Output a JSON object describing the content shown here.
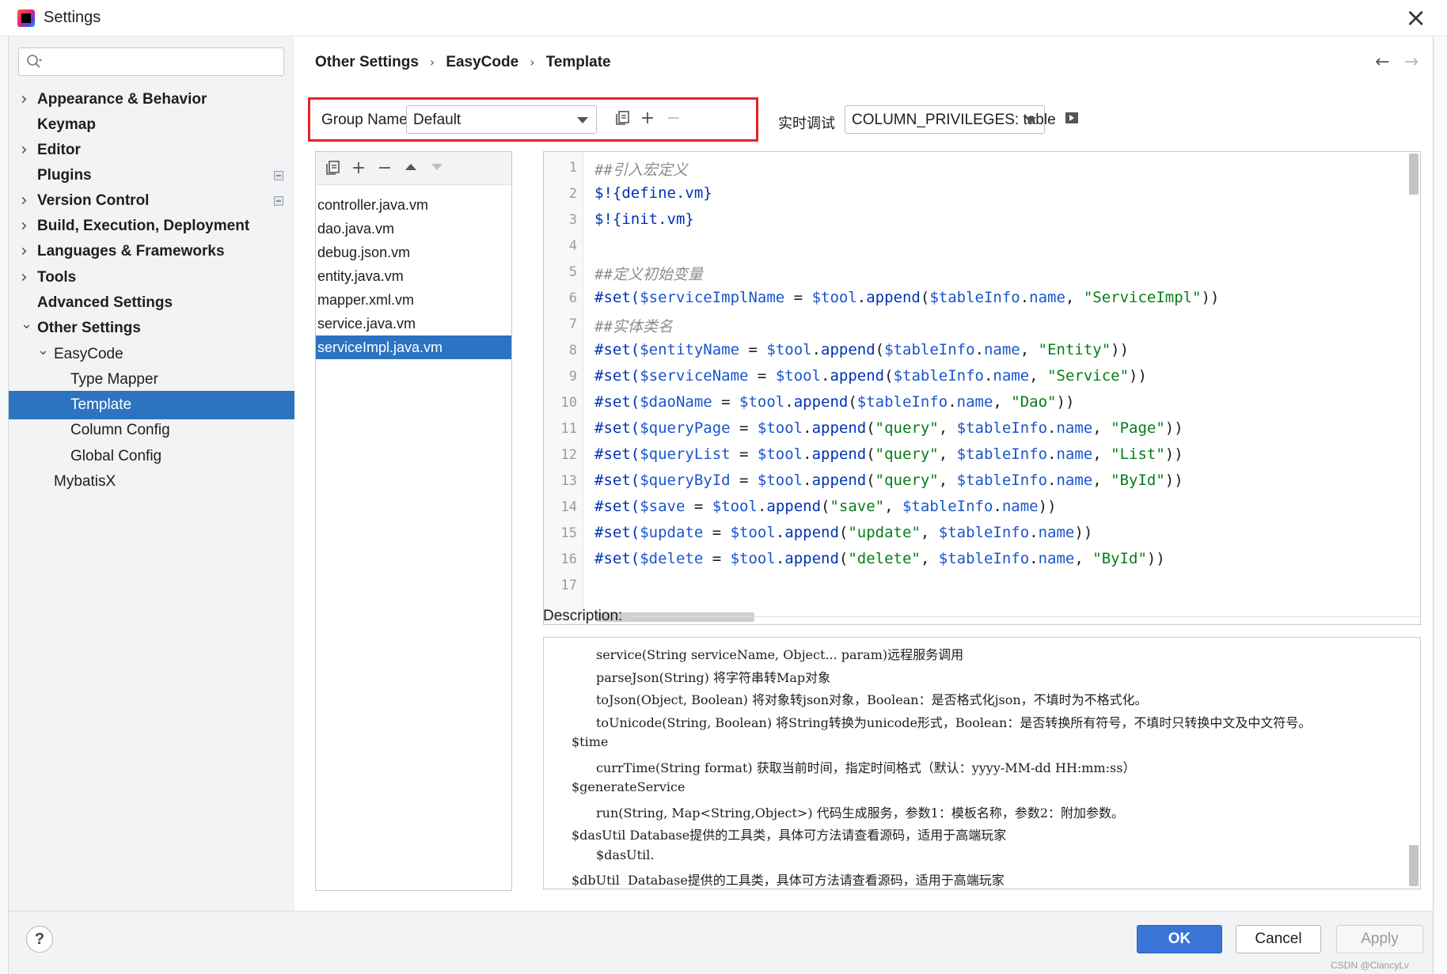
{
  "window": {
    "title": "Settings"
  },
  "sidebar": {
    "search_placeholder": "",
    "items": [
      {
        "label": "Appearance & Behavior",
        "bold": true,
        "chevron": "right",
        "indent": 0
      },
      {
        "label": "Keymap",
        "bold": true,
        "chevron": "none",
        "indent": 0
      },
      {
        "label": "Editor",
        "bold": true,
        "chevron": "right",
        "indent": 0
      },
      {
        "label": "Plugins",
        "bold": true,
        "chevron": "none",
        "indent": 0,
        "badge": true
      },
      {
        "label": "Version Control",
        "bold": true,
        "chevron": "right",
        "indent": 0,
        "badge": true
      },
      {
        "label": "Build, Execution, Deployment",
        "bold": true,
        "chevron": "right",
        "indent": 0
      },
      {
        "label": "Languages & Frameworks",
        "bold": true,
        "chevron": "right",
        "indent": 0
      },
      {
        "label": "Tools",
        "bold": true,
        "chevron": "right",
        "indent": 0
      },
      {
        "label": "Advanced Settings",
        "bold": true,
        "chevron": "none",
        "indent": 0
      },
      {
        "label": "Other Settings",
        "bold": true,
        "chevron": "down",
        "indent": 0
      },
      {
        "label": "EasyCode",
        "bold": false,
        "chevron": "down",
        "indent": 1
      },
      {
        "label": "Type Mapper",
        "bold": false,
        "chevron": "none",
        "indent": 2
      },
      {
        "label": "Template",
        "bold": false,
        "chevron": "none",
        "indent": 2,
        "selected": true
      },
      {
        "label": "Column Config",
        "bold": false,
        "chevron": "none",
        "indent": 2
      },
      {
        "label": "Global Config",
        "bold": false,
        "chevron": "none",
        "indent": 2
      },
      {
        "label": "MybatisX",
        "bold": false,
        "chevron": "none",
        "indent": 1
      }
    ]
  },
  "breadcrumb": [
    "Other Settings",
    "EasyCode",
    "Template"
  ],
  "group": {
    "label": "Group Name:",
    "value": "Default",
    "highlight_color": "#e8202a"
  },
  "debug": {
    "label": "实时调试",
    "value": "COLUMN_PRIVILEGES: table"
  },
  "templates": {
    "items": [
      "controller.java.vm",
      "dao.java.vm",
      "debug.json.vm",
      "entity.java.vm",
      "mapper.xml.vm",
      "service.java.vm",
      "serviceImpl.java.vm"
    ],
    "selected_index": 6
  },
  "editor": {
    "lines": [
      {
        "n": "1",
        "t": [
          [
            "c",
            "##引入宏定义"
          ]
        ]
      },
      {
        "n": "2",
        "t": [
          [
            "k",
            "$!{define.vm}"
          ]
        ]
      },
      {
        "n": "3",
        "t": [
          [
            "k",
            "$!{init.vm}"
          ]
        ]
      },
      {
        "n": "4",
        "t": []
      },
      {
        "n": "5",
        "t": [
          [
            "c",
            "##定义初始变量"
          ]
        ]
      },
      {
        "n": "6",
        "t": [
          [
            "k",
            "#set("
          ],
          [
            "v",
            "$serviceImplName"
          ],
          [
            "p",
            " = "
          ],
          [
            "v",
            "$tool"
          ],
          [
            "p",
            "."
          ],
          [
            "k",
            "append"
          ],
          [
            "p",
            "("
          ],
          [
            "v",
            "$tableInfo"
          ],
          [
            "p",
            "."
          ],
          [
            "v",
            "name"
          ],
          [
            "p",
            ", "
          ],
          [
            "s",
            "\"ServiceImpl\""
          ],
          [
            "p",
            "))"
          ]
        ]
      },
      {
        "n": "7",
        "t": [
          [
            "c",
            "##实体类名"
          ]
        ]
      },
      {
        "n": "8",
        "t": [
          [
            "k",
            "#set("
          ],
          [
            "v",
            "$entityName"
          ],
          [
            "p",
            " = "
          ],
          [
            "v",
            "$tool"
          ],
          [
            "p",
            "."
          ],
          [
            "k",
            "append"
          ],
          [
            "p",
            "("
          ],
          [
            "v",
            "$tableInfo"
          ],
          [
            "p",
            "."
          ],
          [
            "v",
            "name"
          ],
          [
            "p",
            ", "
          ],
          [
            "s",
            "\"Entity\""
          ],
          [
            "p",
            "))"
          ]
        ]
      },
      {
        "n": "9",
        "t": [
          [
            "k",
            "#set("
          ],
          [
            "v",
            "$serviceName"
          ],
          [
            "p",
            " = "
          ],
          [
            "v",
            "$tool"
          ],
          [
            "p",
            "."
          ],
          [
            "k",
            "append"
          ],
          [
            "p",
            "("
          ],
          [
            "v",
            "$tableInfo"
          ],
          [
            "p",
            "."
          ],
          [
            "v",
            "name"
          ],
          [
            "p",
            ", "
          ],
          [
            "s",
            "\"Service\""
          ],
          [
            "p",
            "))"
          ]
        ]
      },
      {
        "n": "10",
        "t": [
          [
            "k",
            "#set("
          ],
          [
            "v",
            "$daoName"
          ],
          [
            "p",
            " = "
          ],
          [
            "v",
            "$tool"
          ],
          [
            "p",
            "."
          ],
          [
            "k",
            "append"
          ],
          [
            "p",
            "("
          ],
          [
            "v",
            "$tableInfo"
          ],
          [
            "p",
            "."
          ],
          [
            "v",
            "name"
          ],
          [
            "p",
            ", "
          ],
          [
            "s",
            "\"Dao\""
          ],
          [
            "p",
            "))"
          ]
        ]
      },
      {
        "n": "11",
        "t": [
          [
            "k",
            "#set("
          ],
          [
            "v",
            "$queryPage"
          ],
          [
            "p",
            " = "
          ],
          [
            "v",
            "$tool"
          ],
          [
            "p",
            "."
          ],
          [
            "k",
            "append"
          ],
          [
            "p",
            "("
          ],
          [
            "s",
            "\"query\""
          ],
          [
            "p",
            ", "
          ],
          [
            "v",
            "$tableInfo"
          ],
          [
            "p",
            "."
          ],
          [
            "v",
            "name"
          ],
          [
            "p",
            ", "
          ],
          [
            "s",
            "\"Page\""
          ],
          [
            "p",
            "))"
          ]
        ]
      },
      {
        "n": "12",
        "t": [
          [
            "k",
            "#set("
          ],
          [
            "v",
            "$queryList"
          ],
          [
            "p",
            " = "
          ],
          [
            "v",
            "$tool"
          ],
          [
            "p",
            "."
          ],
          [
            "k",
            "append"
          ],
          [
            "p",
            "("
          ],
          [
            "s",
            "\"query\""
          ],
          [
            "p",
            ", "
          ],
          [
            "v",
            "$tableInfo"
          ],
          [
            "p",
            "."
          ],
          [
            "v",
            "name"
          ],
          [
            "p",
            ", "
          ],
          [
            "s",
            "\"List\""
          ],
          [
            "p",
            "))"
          ]
        ]
      },
      {
        "n": "13",
        "t": [
          [
            "k",
            "#set("
          ],
          [
            "v",
            "$queryById"
          ],
          [
            "p",
            " = "
          ],
          [
            "v",
            "$tool"
          ],
          [
            "p",
            "."
          ],
          [
            "k",
            "append"
          ],
          [
            "p",
            "("
          ],
          [
            "s",
            "\"query\""
          ],
          [
            "p",
            ", "
          ],
          [
            "v",
            "$tableInfo"
          ],
          [
            "p",
            "."
          ],
          [
            "v",
            "name"
          ],
          [
            "p",
            ", "
          ],
          [
            "s",
            "\"ById\""
          ],
          [
            "p",
            "))"
          ]
        ]
      },
      {
        "n": "14",
        "t": [
          [
            "k",
            "#set("
          ],
          [
            "v",
            "$save"
          ],
          [
            "p",
            " = "
          ],
          [
            "v",
            "$tool"
          ],
          [
            "p",
            "."
          ],
          [
            "k",
            "append"
          ],
          [
            "p",
            "("
          ],
          [
            "s",
            "\"save\""
          ],
          [
            "p",
            ", "
          ],
          [
            "v",
            "$tableInfo"
          ],
          [
            "p",
            "."
          ],
          [
            "v",
            "name"
          ],
          [
            "p",
            "))"
          ]
        ]
      },
      {
        "n": "15",
        "t": [
          [
            "k",
            "#set("
          ],
          [
            "v",
            "$update"
          ],
          [
            "p",
            " = "
          ],
          [
            "v",
            "$tool"
          ],
          [
            "p",
            "."
          ],
          [
            "k",
            "append"
          ],
          [
            "p",
            "("
          ],
          [
            "s",
            "\"update\""
          ],
          [
            "p",
            ", "
          ],
          [
            "v",
            "$tableInfo"
          ],
          [
            "p",
            "."
          ],
          [
            "v",
            "name"
          ],
          [
            "p",
            "))"
          ]
        ]
      },
      {
        "n": "16",
        "t": [
          [
            "k",
            "#set("
          ],
          [
            "v",
            "$delete"
          ],
          [
            "p",
            " = "
          ],
          [
            "v",
            "$tool"
          ],
          [
            "p",
            "."
          ],
          [
            "k",
            "append"
          ],
          [
            "p",
            "("
          ],
          [
            "s",
            "\"delete\""
          ],
          [
            "p",
            ", "
          ],
          [
            "v",
            "$tableInfo"
          ],
          [
            "p",
            "."
          ],
          [
            "v",
            "name"
          ],
          [
            "p",
            ", "
          ],
          [
            "s",
            "\"ById\""
          ],
          [
            "p",
            "))"
          ]
        ]
      },
      {
        "n": "17",
        "t": []
      }
    ]
  },
  "description": {
    "label": "Description:",
    "lines": [
      {
        "indent": 2,
        "text": "service(String serviceName, Object... param)远程服务调用"
      },
      {
        "indent": 2,
        "text": "parseJson(String) 将字符串转Map对象"
      },
      {
        "indent": 2,
        "text": "toJson(Object, Boolean) 将对象转json对象，Boolean：是否格式化json，不填时为不格式化。"
      },
      {
        "indent": 2,
        "text": "toUnicode(String, Boolean) 将String转换为unicode形式，Boolean：是否转换所有符号，不填时只转换中文及中文符号。"
      },
      {
        "indent": 1,
        "text": "$time"
      },
      {
        "indent": 2,
        "text": "currTime(String format) 获取当前时间，指定时间格式（默认：yyyy-MM-dd HH:mm:ss）"
      },
      {
        "indent": 1,
        "text": "$generateService"
      },
      {
        "indent": 2,
        "text": "run(String, Map<String,Object>) 代码生成服务，参数1：模板名称，参数2：附加参数。"
      },
      {
        "indent": 1,
        "text": "$dasUtil Database提供的工具类，具体可方法请查看源码，适用于高端玩家"
      },
      {
        "indent": 2,
        "text": "$dasUtil."
      },
      {
        "indent": 1,
        "text": "$dbUtil  Database提供的工具类，具体可方法请查看源码，适用于高端玩家"
      }
    ]
  },
  "footer": {
    "help": "?",
    "ok": "OK",
    "cancel": "Cancel",
    "apply": "Apply",
    "watermark": "CSDN @ClancyLv"
  }
}
